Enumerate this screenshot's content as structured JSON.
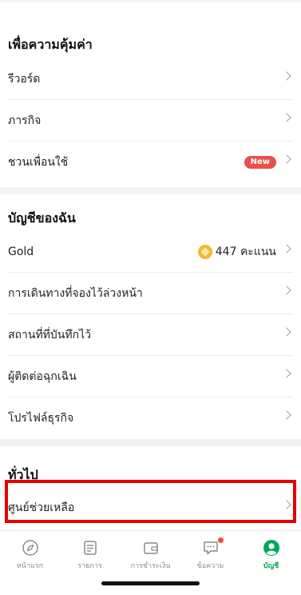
{
  "sections": {
    "value": {
      "title": "เพื่อความคุ้มค่า",
      "items": [
        {
          "label": "รีวอร์ด"
        },
        {
          "label": "ภารกิจ"
        },
        {
          "label": "ชวนเพื่อนใช้",
          "badge": "New"
        }
      ]
    },
    "account": {
      "title": "บัญชีของฉัน",
      "items": [
        {
          "label": "Gold",
          "value": "447 คะแนน"
        },
        {
          "label": "การเดินทางที่จองไว้ล่วงหน้า"
        },
        {
          "label": "สถานที่ที่บันทึกไว้"
        },
        {
          "label": "ผู้ติดต่อฉุกเฉิน"
        },
        {
          "label": "โปรไฟล์ธุรกิจ"
        }
      ]
    },
    "general": {
      "title": "ทั่วไป",
      "items": [
        {
          "label": "ศูนย์ช่วยเหลือ"
        }
      ]
    }
  },
  "bottom_nav": {
    "items": [
      {
        "label": "หน้าแรก",
        "icon": "compass-icon"
      },
      {
        "label": "รายการ",
        "icon": "list-icon"
      },
      {
        "label": "การชำระเงิน",
        "icon": "wallet-icon"
      },
      {
        "label": "ข้อความ",
        "icon": "chat-icon"
      },
      {
        "label": "บัญชี",
        "icon": "account-icon",
        "active": true
      }
    ]
  },
  "colors": {
    "accent_green": "#06a85b",
    "badge_red": "#e8504a",
    "highlight_red": "#e60000",
    "coin_gold": "#f5b731"
  }
}
